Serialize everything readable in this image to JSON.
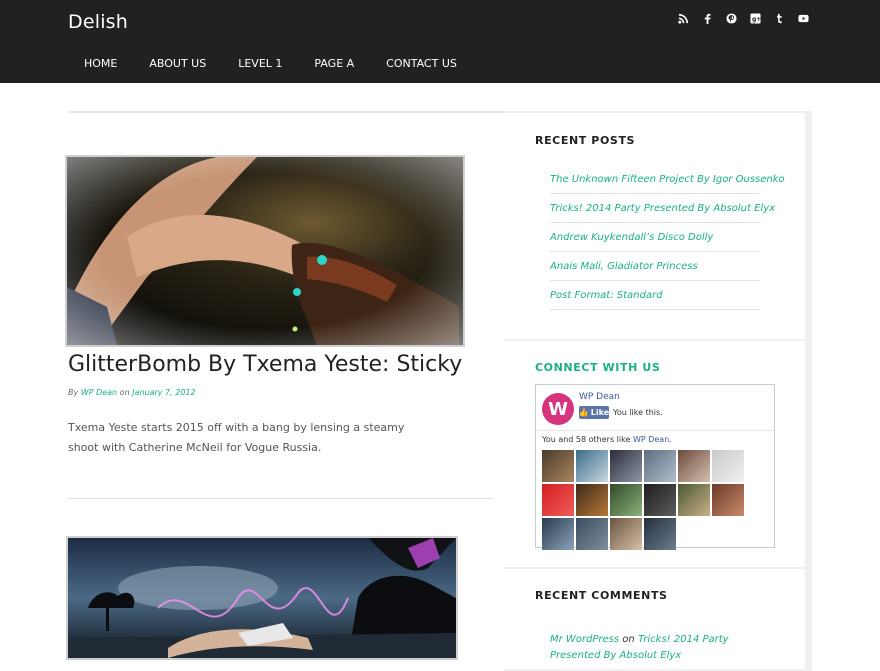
{
  "site": {
    "title": "Delish"
  },
  "social": [
    "rss-icon",
    "facebook-icon",
    "pinterest-icon",
    "google-plus-icon",
    "tumblr-icon",
    "youtube-icon"
  ],
  "nav": {
    "items": [
      "HOME",
      "ABOUT US",
      "LEVEL 1",
      "PAGE A",
      "CONTACT US"
    ]
  },
  "post": {
    "title": "GlitterBomb By Txema Yeste: Sticky",
    "meta_by": "By",
    "author": "WP Dean",
    "meta_on": "on",
    "date": "January 7, 2012",
    "excerpt": "Txema Yeste starts 2015 off with a bang by lensing a steamy shoot with Catherine McNeil for Vogue Russia."
  },
  "sidebar": {
    "recent_posts": {
      "title": "RECENT POSTS",
      "items": [
        "The Unknown Fifteen Project By Igor Oussenko",
        "Tricks! 2014 Party Presented By Absolut Elyx",
        "Andrew Kuykendall’s Disco Dolly",
        "Anais Mali, Gladiator Princess",
        "Post Format: Standard"
      ]
    },
    "connect": {
      "title": "CONNECT WITH US",
      "fb_logo": "W",
      "fb_page": "WP Dean",
      "fb_like": "Like",
      "fb_you_like": "You like this.",
      "fb_others_prefix": "You and 58 others like",
      "fb_others_page": "WP Dean."
    },
    "recent_comments": {
      "title": "RECENT COMMENTS",
      "author": "Mr WordPress",
      "on": "on",
      "post": "Tricks! 2014 Party Presented By Absolut Elyx"
    }
  },
  "colors": {
    "accent": "#1aaf88",
    "header_bg": "#212121",
    "fb_blue": "#3b5998",
    "fb_logo_bg": "#d6357e"
  }
}
